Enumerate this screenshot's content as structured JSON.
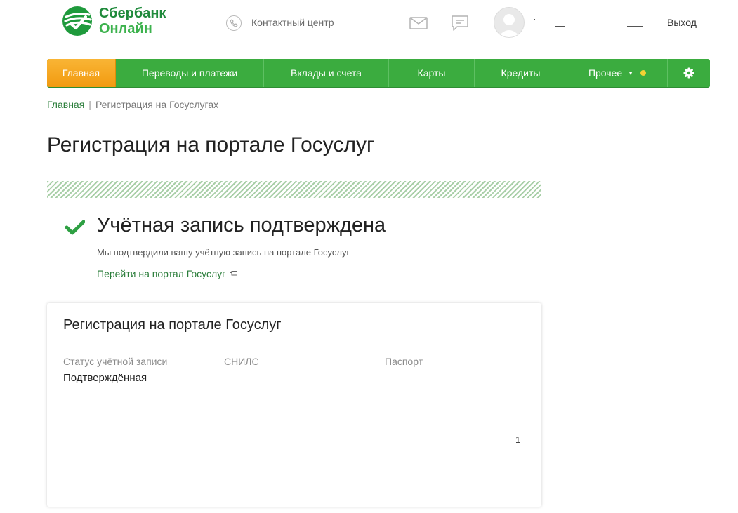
{
  "header": {
    "logo": {
      "line1": "Сбербанк",
      "line2": "Онлайн"
    },
    "contact_center_label": "Контактный центр",
    "logout_label": "Выход"
  },
  "nav": {
    "items": [
      {
        "label": "Главная",
        "active": true
      },
      {
        "label": "Переводы и платежи",
        "active": false
      },
      {
        "label": "Вклады и счета",
        "active": false
      },
      {
        "label": "Карты",
        "active": false
      },
      {
        "label": "Кредиты",
        "active": false
      },
      {
        "label": "Прочее",
        "active": false
      }
    ],
    "settings_icon": "gear-icon",
    "colors": {
      "bar": "#3bac3f",
      "active": "#f5a623",
      "dot": "#f3d234"
    }
  },
  "breadcrumb": {
    "home": "Главная",
    "separator": "|",
    "current": "Регистрация на Госуслугах"
  },
  "page": {
    "title": "Регистрация на портале Госуслуг"
  },
  "success": {
    "title": "Учётная запись подтверждена",
    "text": "Мы подтвердили вашу учётную запись на портале Госуслуг",
    "link": "Перейти на портал Госуслуг"
  },
  "card": {
    "title": "Регистрация на портале Госуслуг",
    "fields": [
      {
        "label": "Статус учётной записи",
        "value": "Подтверждённая"
      },
      {
        "label": "СНИЛС",
        "value": ""
      },
      {
        "label": "Паспорт",
        "value": ""
      }
    ],
    "stray_mark": "1"
  }
}
